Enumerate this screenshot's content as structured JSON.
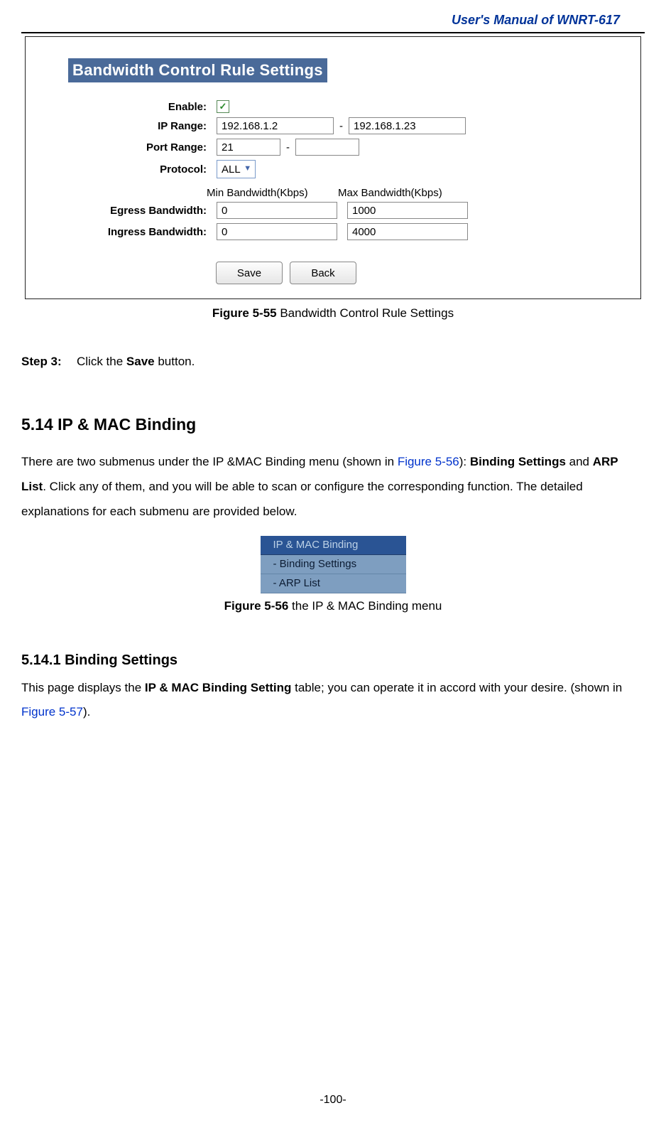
{
  "header": {
    "title": "User's Manual of WNRT-617"
  },
  "figure1": {
    "panel_title": "Bandwidth Control Rule Settings",
    "enable_label": "Enable:",
    "enable_checked": true,
    "ip_range_label": "IP Range:",
    "ip_range_start": "192.168.1.2",
    "ip_range_end": "192.168.1.23",
    "port_range_label": "Port Range:",
    "port_range_start": "21",
    "port_range_end": "",
    "protocol_label": "Protocol:",
    "protocol_value": "ALL",
    "min_bw_header": "Min Bandwidth(Kbps)",
    "max_bw_header": "Max Bandwidth(Kbps)",
    "egress_label": "Egress Bandwidth:",
    "egress_min": "0",
    "egress_max": "1000",
    "ingress_label": "Ingress Bandwidth:",
    "ingress_min": "0",
    "ingress_max": "4000",
    "save_label": "Save",
    "back_label": "Back",
    "caption_bold": "Figure 5-55",
    "caption_text": " Bandwidth Control Rule Settings"
  },
  "step3": {
    "label": "Step 3:",
    "text_a": "Click the ",
    "text_bold": "Save",
    "text_b": " button."
  },
  "section": {
    "title": "5.14  IP & MAC Binding",
    "para_a": "There are two submenus under the IP &MAC Binding menu (shown in ",
    "para_link": "Figure 5-56",
    "para_b": "): ",
    "para_bold1": "Binding Settings",
    "para_c": " and ",
    "para_bold2": "ARP List",
    "para_d": ". Click any of them, and you will be able to scan or configure the corresponding function. The detailed explanations for each submenu are provided below."
  },
  "menu": {
    "header": "IP & MAC Binding",
    "item1": "- Binding Settings",
    "item2": "- ARP List"
  },
  "figure2": {
    "caption_bold": "Figure 5-56",
    "caption_text": " the IP & MAC Binding menu"
  },
  "subsection": {
    "title": "5.14.1 Binding Settings",
    "para_a": "This page displays the ",
    "para_bold": "IP & MAC Binding Setting",
    "para_b": " table; you can operate it in accord with your desire. (shown in ",
    "para_link": "Figure 5-57",
    "para_c": ")."
  },
  "footer": {
    "page_no": "-100-"
  }
}
